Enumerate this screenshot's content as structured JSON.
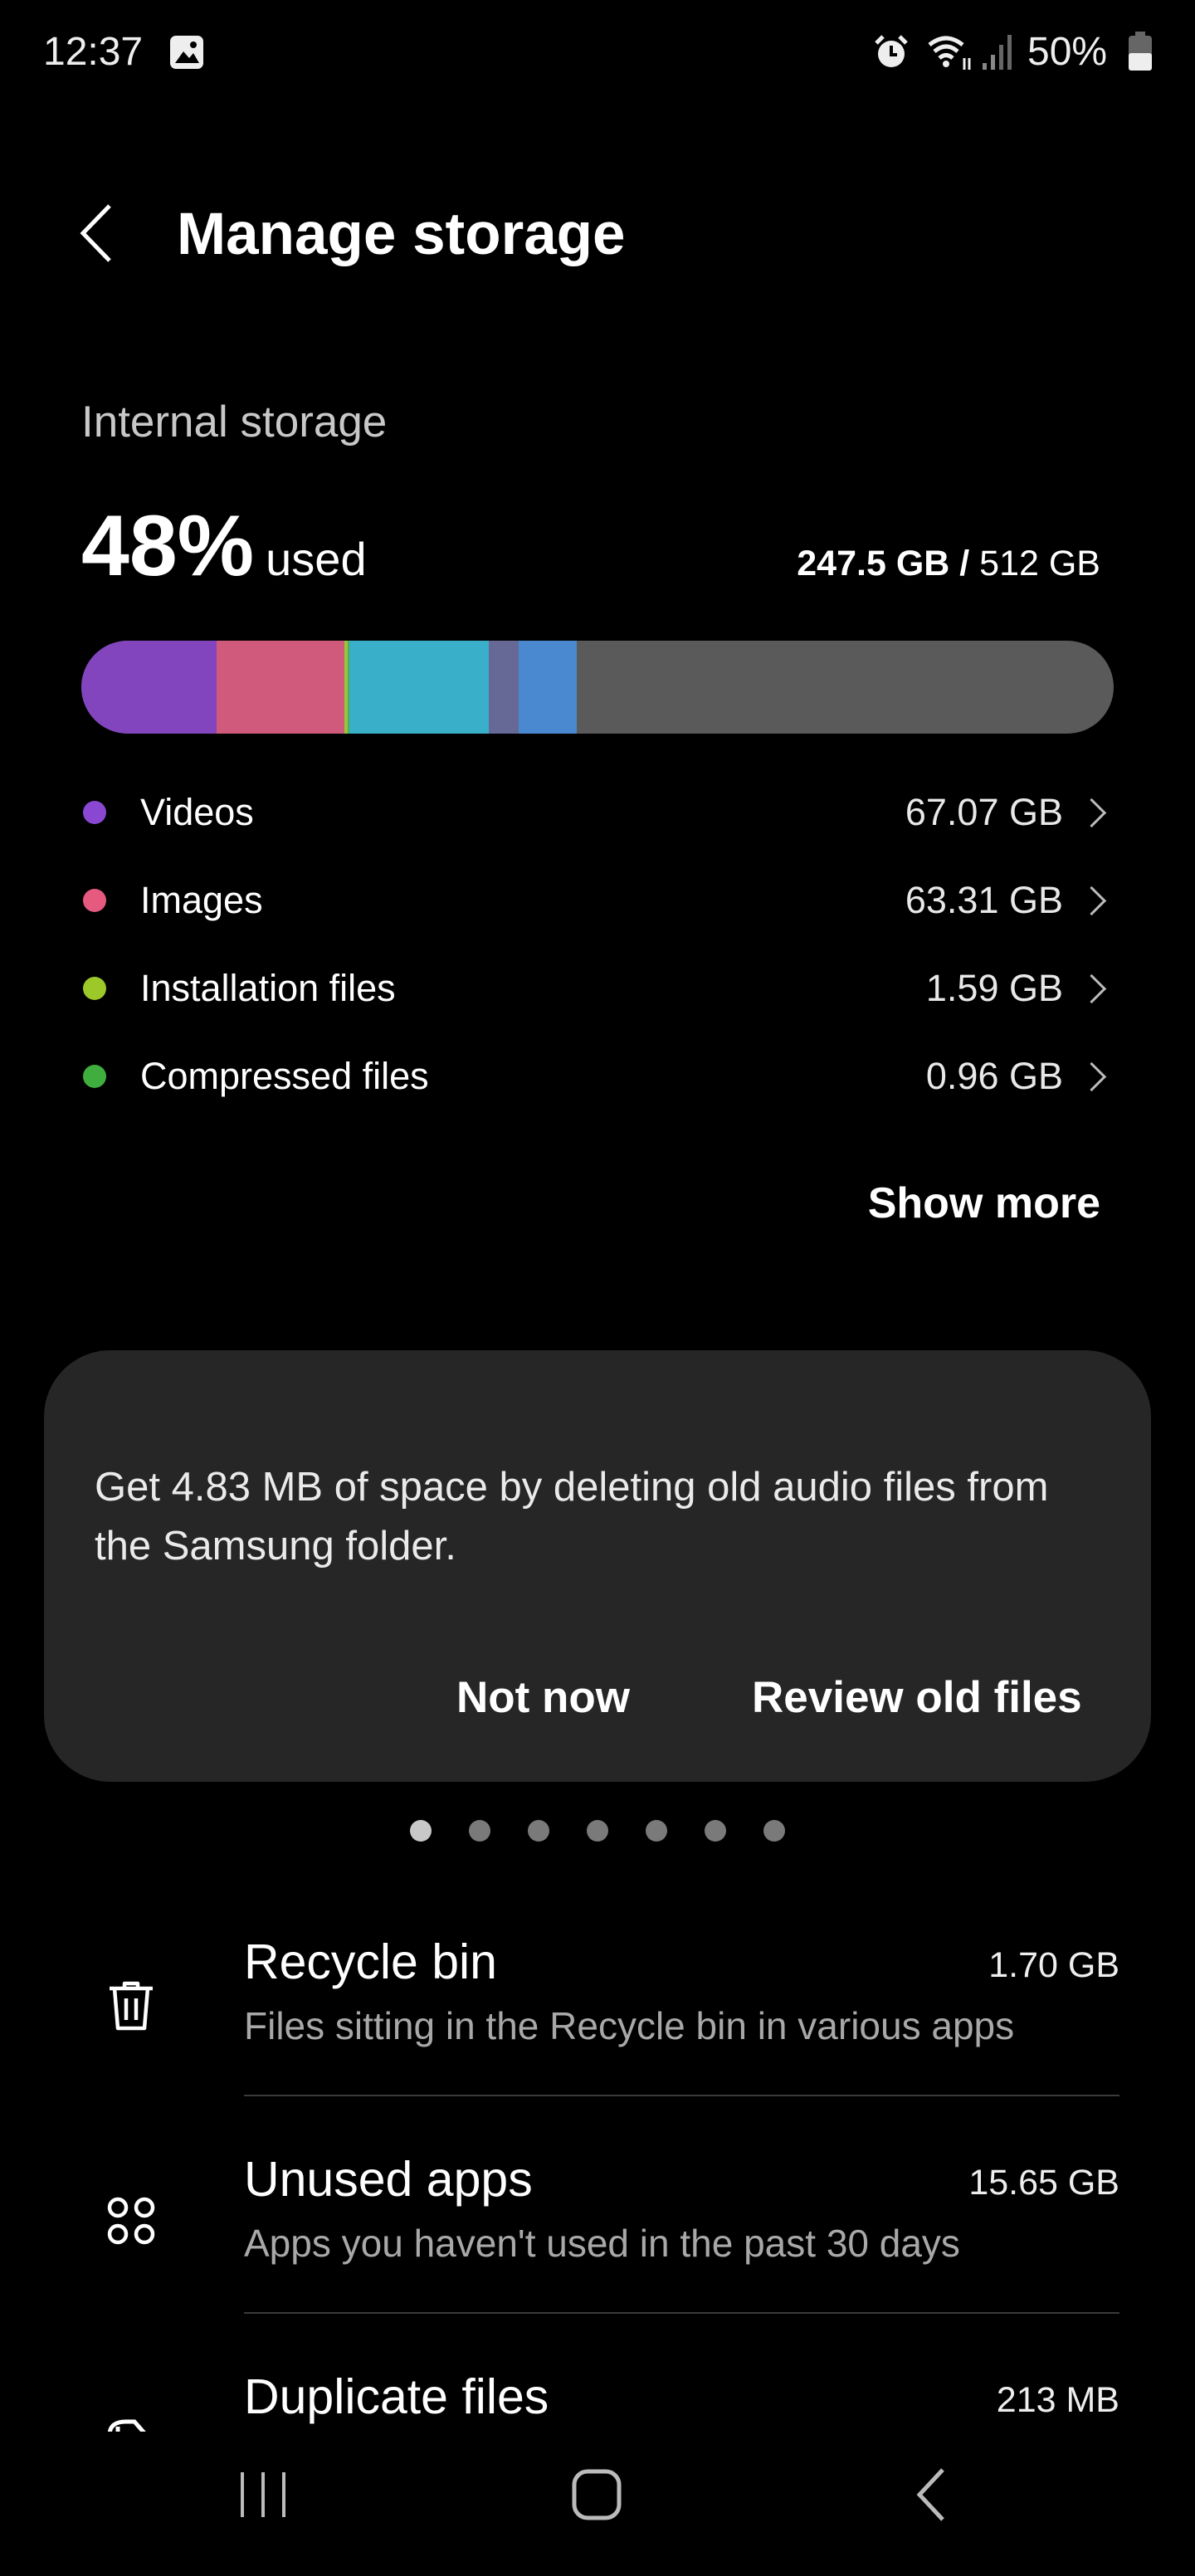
{
  "status_bar": {
    "time": "12:37",
    "battery": "50%",
    "icons": [
      "gallery-icon",
      "alarm-icon",
      "wifi-icon",
      "signal-icon",
      "battery-icon"
    ]
  },
  "header": {
    "title": "Manage storage",
    "back_icon": "chevron-left-icon"
  },
  "storage": {
    "section_label": "Internal storage",
    "percent_used": "48%",
    "used_suffix": "used",
    "used_amount": "247.5 GB",
    "separator": " / ",
    "total_amount": "512 GB",
    "used_fraction": 0.48,
    "bar_segments": [
      {
        "color": "#8245bd",
        "fraction": 0.131
      },
      {
        "color": "#d05a7c",
        "fraction": 0.124
      },
      {
        "color": "#9cc43a",
        "fraction": 0.003
      },
      {
        "color": "#4caf50",
        "fraction": 0.002
      },
      {
        "color": "#3aafca",
        "fraction": 0.135
      },
      {
        "color": "#666896",
        "fraction": 0.029
      },
      {
        "color": "#4a88cf",
        "fraction": 0.056
      }
    ],
    "categories": [
      {
        "label": "Videos",
        "size": "67.07 GB",
        "color": "#8a48d2"
      },
      {
        "label": "Images",
        "size": "63.31 GB",
        "color": "#e65a80"
      },
      {
        "label": "Installation files",
        "size": "1.59 GB",
        "color": "#9cc82a"
      },
      {
        "label": "Compressed files",
        "size": "0.96 GB",
        "color": "#3fae3f"
      }
    ],
    "show_more": "Show more"
  },
  "suggestion_card": {
    "message": "Get 4.83 MB of space by deleting old audio files from the Samsung folder.",
    "dismiss": "Not now",
    "action": "Review old files",
    "page_count": 7,
    "active_page": 1
  },
  "items": [
    {
      "title": "Recycle bin",
      "subtitle": "Files sitting in the Recycle bin in various apps",
      "size": "1.70 GB",
      "icon": "trash-icon"
    },
    {
      "title": "Unused apps",
      "subtitle": "Apps you haven't used in the past 30 days",
      "size": "15.65 GB",
      "icon": "apps-icon"
    },
    {
      "title": "Duplicate files",
      "subtitle": "",
      "size": "213 MB",
      "icon": "duplicate-icon"
    }
  ],
  "nav_bar": {
    "icons": [
      "recents-icon",
      "home-icon",
      "back-icon"
    ]
  }
}
